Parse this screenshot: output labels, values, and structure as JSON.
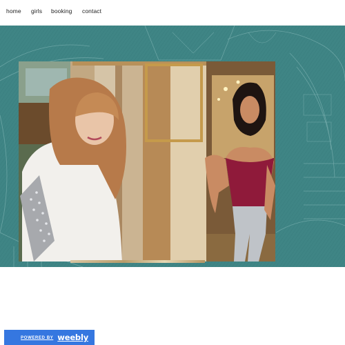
{
  "nav": {
    "items": [
      {
        "label": "home"
      },
      {
        "label": "girls"
      },
      {
        "label": "booking"
      },
      {
        "label": "contact"
      }
    ]
  },
  "banner": {
    "background_color": "#3f8585",
    "image_description_icon": "photo-collage-image"
  },
  "footer_badge": {
    "prefix": "POWERED BY",
    "brand": "weebly",
    "color": "#3577e0"
  }
}
